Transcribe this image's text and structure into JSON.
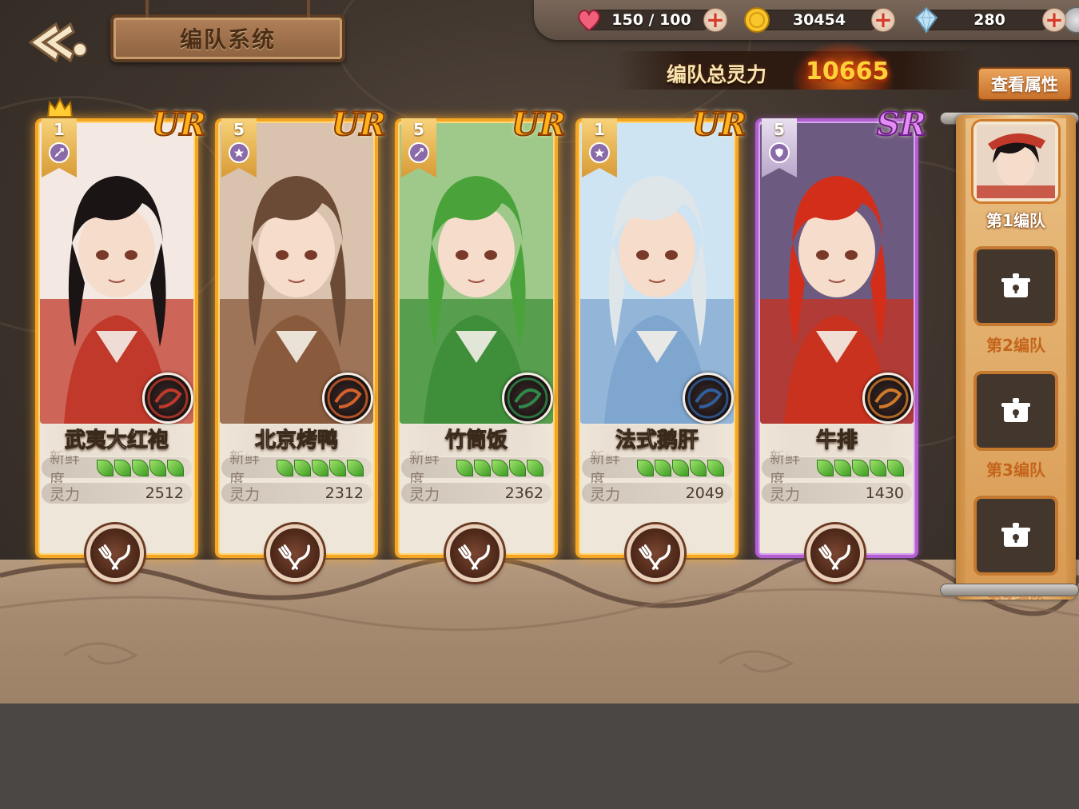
{
  "header": {
    "title": "编队系统"
  },
  "resources": {
    "stamina": "150 / 100",
    "gold": "30454",
    "crystal": "280"
  },
  "team_power": {
    "label": "编队总灵力",
    "value": "10665"
  },
  "view_attributes_label": "查看属性",
  "stat_labels": {
    "freshness": "新鲜度",
    "power": "灵力"
  },
  "cards": [
    {
      "name": "武夷大红袍",
      "rarity": "UR",
      "level": "1",
      "power": "2512",
      "freshness": 5,
      "role_icon": "sword-icon",
      "leader": true,
      "accent": "#c0392b"
    },
    {
      "name": "北京烤鸭",
      "rarity": "UR",
      "level": "5",
      "power": "2312",
      "freshness": 5,
      "role_icon": "star-icon",
      "leader": false,
      "accent": "#8a5a3c"
    },
    {
      "name": "竹筒饭",
      "rarity": "UR",
      "level": "5",
      "power": "2362",
      "freshness": 5,
      "role_icon": "sword-icon",
      "leader": false,
      "accent": "#3f8f3a"
    },
    {
      "name": "法式鹅肝",
      "rarity": "UR",
      "level": "1",
      "power": "2049",
      "freshness": 5,
      "role_icon": "star-icon",
      "leader": false,
      "accent": "#7fa6cf"
    },
    {
      "name": "牛排",
      "rarity": "SR",
      "level": "5",
      "power": "1430",
      "freshness": 5,
      "role_icon": "shield-icon",
      "leader": false,
      "accent": "#c8321e"
    }
  ],
  "teams": [
    {
      "label": "第1编队",
      "state": "active"
    },
    {
      "label": "第2编队",
      "state": "locked"
    },
    {
      "label": "第3编队",
      "state": "locked"
    },
    {
      "label": "第4编队",
      "state": "locked"
    }
  ],
  "colors": {
    "ur_frame": "#f5a623",
    "sr_frame": "#b25fd1",
    "power_value": "#ffd23a",
    "button": "#c7702a"
  }
}
